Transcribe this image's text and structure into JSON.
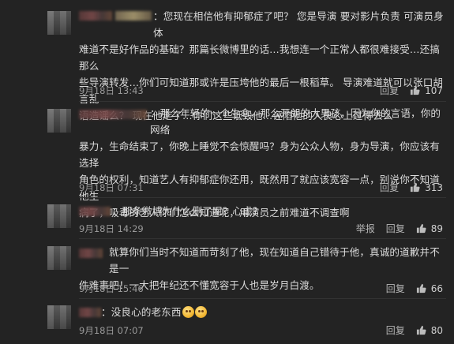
{
  "comments": [
    {
      "text_l1": "：您现在相信他有抑郁症了吧？ 您是导演  要对影片负责  可演员身体",
      "text_l2": "难道不是好作品的基础？那篇长微博里的话…我想连一个正常人都很难接受…还搞那么",
      "text_l3": "些导演转发…你们可知道那或许是压垮他的最后一根稻草。 导演难道就可以张口胡言乱",
      "text_l4": "语造谣么？ 现在他走了…你们这些诋毁他…诬陷他的人良心上过得去么",
      "time": "9月18日 13:43",
      "reply": "回复",
      "likes": "107"
    },
    {
      "text_l1": "：那么年轻的一个生命，那么开朗的大男孩，因为你的言语，你的网络",
      "text_l2": "暴力，生命结束了，你晚上睡觉不会惊醒吗？身为公众人物，身为导演，你应该有选择",
      "text_l3": "角色的权利，知道艺人有抑郁症你还用，既然用了就应该宽容一点，别说你不知道他生",
      "text_l4": "病了，吸毒的艺人你们怎么知道呢，用演员之前难道不调查啊",
      "time": "9月18日 07:31",
      "reply": "回复",
      "likes": "313"
    },
    {
      "text_l1": "：那条微博为什么删了呢？心虚？",
      "time": "9月18日 14:29",
      "report": "举报",
      "reply": "回复",
      "likes": "89"
    },
    {
      "text_l1": "就算你们当时不知道而苛刻了他，现在知道自己错待于他，真诚的道歉并不是一",
      "text_l2": "件难事吧！一大把年纪还不懂宽容于人也是岁月白渡。",
      "time": "9月18日 15:46",
      "reply": "回复",
      "likes": "66"
    },
    {
      "text_l1": "：没良心的老东西",
      "time": "9月18日 07:07",
      "reply": "回复",
      "likes": "80"
    }
  ]
}
